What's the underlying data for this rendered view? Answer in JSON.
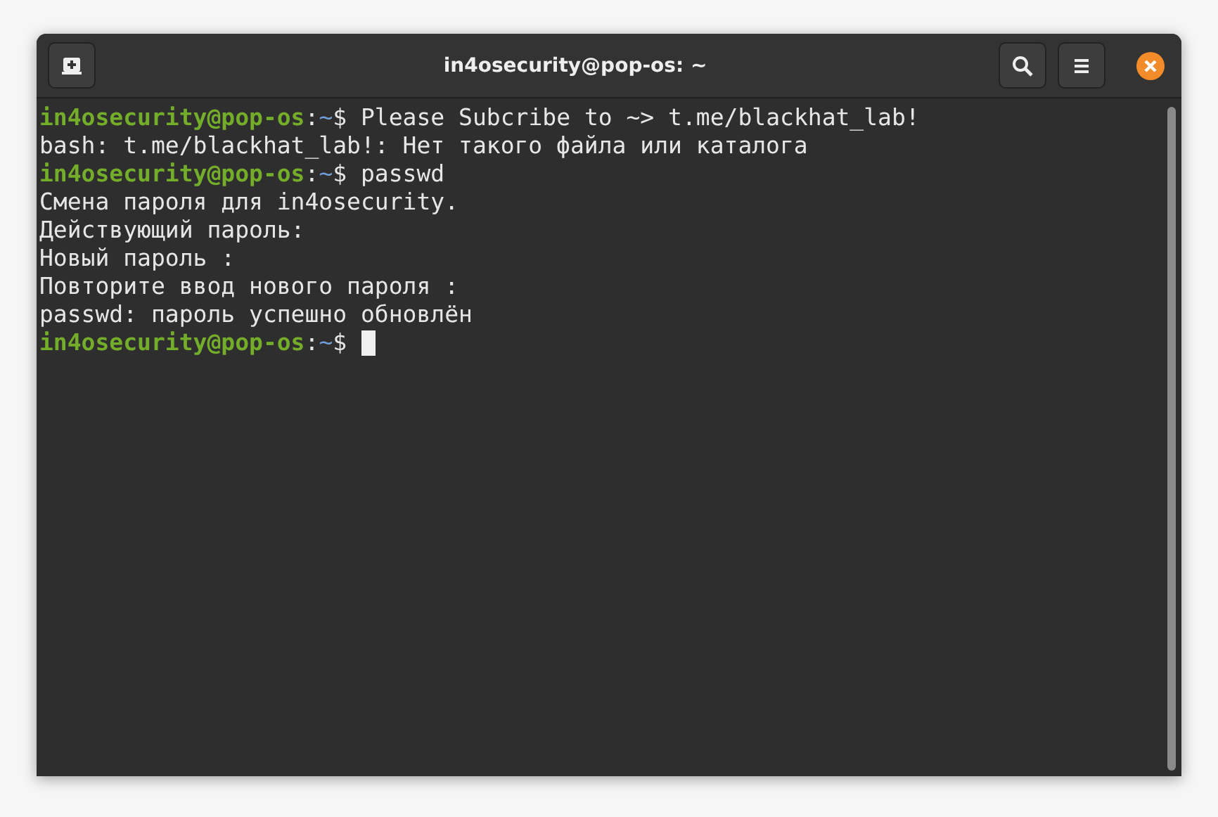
{
  "window": {
    "title": "in4osecurity@pop-os: ~"
  },
  "terminal": {
    "lines": [
      {
        "prompt": {
          "user_host": "in4osecurity@pop-os",
          "separator": ":",
          "path": "~",
          "symbol": "$"
        },
        "text": "Please Subcribe to ~> t.me/blackhat_lab!"
      },
      {
        "text": "bash: t.me/blackhat_lab!: Нет такого файла или каталога"
      },
      {
        "prompt": {
          "user_host": "in4osecurity@pop-os",
          "separator": ":",
          "path": "~",
          "symbol": "$"
        },
        "text": "passwd"
      },
      {
        "text": "Смена пароля для in4osecurity."
      },
      {
        "text": "Действующий пароль:"
      },
      {
        "text": "Новый пароль :"
      },
      {
        "text": "Повторите ввод нового пароля :"
      },
      {
        "text": "passwd: пароль успешно обновлён"
      },
      {
        "prompt": {
          "user_host": "in4osecurity@pop-os",
          "separator": ":",
          "path": "~",
          "symbol": "$"
        },
        "cursor": true
      }
    ]
  }
}
